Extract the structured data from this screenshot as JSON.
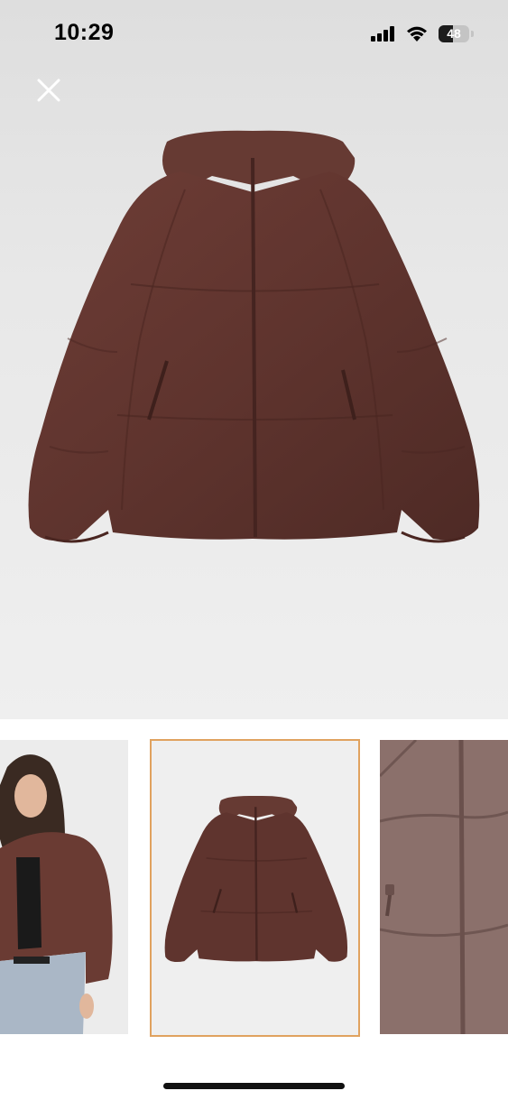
{
  "status_bar": {
    "time": "10:29",
    "battery_level": "48",
    "battery_fraction": 0.48,
    "icons": [
      "cellular-signal-icon",
      "wifi-icon",
      "battery-icon"
    ]
  },
  "viewer": {
    "close_icon": "close-icon",
    "product_color": "#5e342e",
    "selected_thumbnail_index": 1,
    "selected_border_color": "#e0a25f"
  },
  "thumbnails": [
    {
      "name": "model-wearing-jacket"
    },
    {
      "name": "jacket-front-view"
    },
    {
      "name": "jacket-fabric-detail"
    }
  ]
}
